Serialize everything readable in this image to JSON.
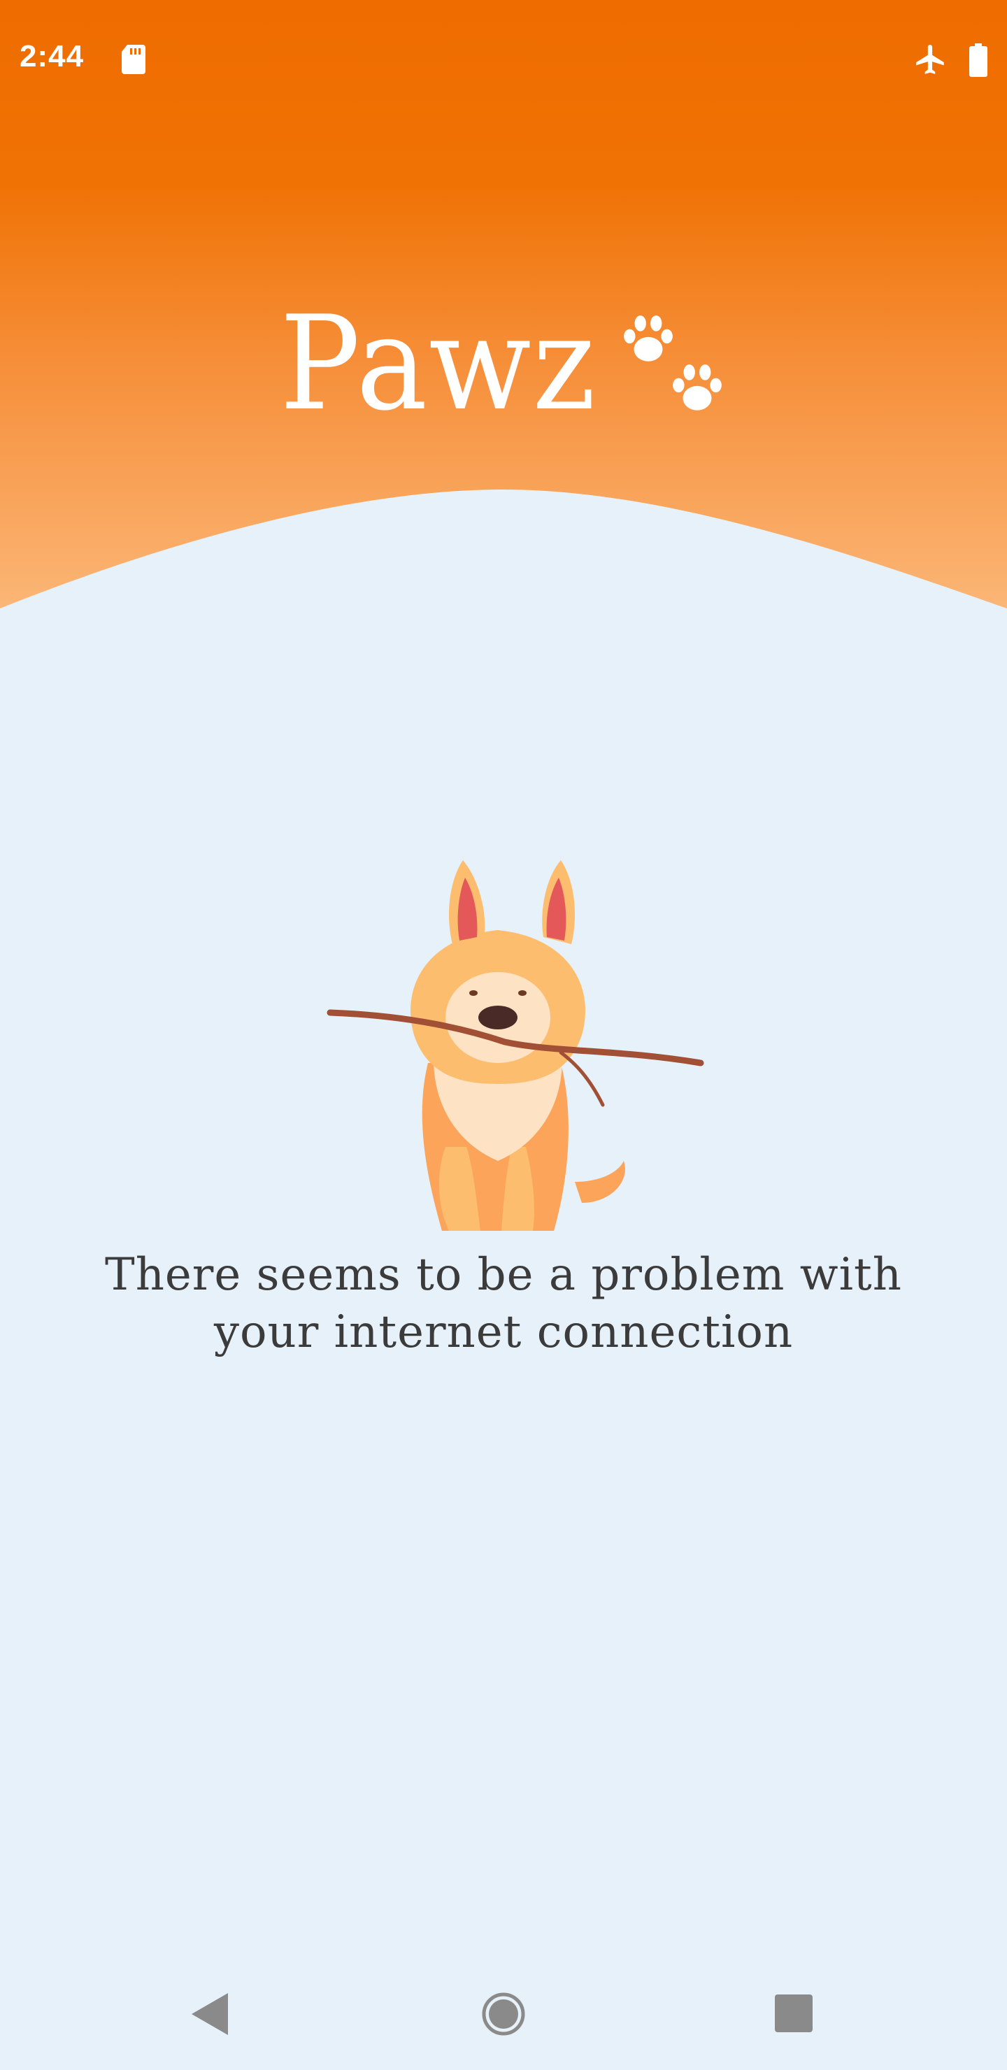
{
  "status_bar": {
    "time": "2:44",
    "icons": [
      "sd-card-icon",
      "airplane-mode-icon",
      "battery-icon"
    ]
  },
  "app": {
    "logo_text": "Pawz",
    "logo_icon": "paw-prints-icon"
  },
  "error": {
    "illustration": "dog-with-stick",
    "message": "There seems to be a problem with your internet connection"
  },
  "nav_bar": {
    "icons": [
      "back-icon",
      "home-icon",
      "recents-icon"
    ]
  },
  "colors": {
    "header_top": "#ef6c00",
    "header_bottom": "#fbb270",
    "background": "#e6f1f9",
    "message_text": "#3b3b3b",
    "nav_icon": "#8a8a8a"
  }
}
